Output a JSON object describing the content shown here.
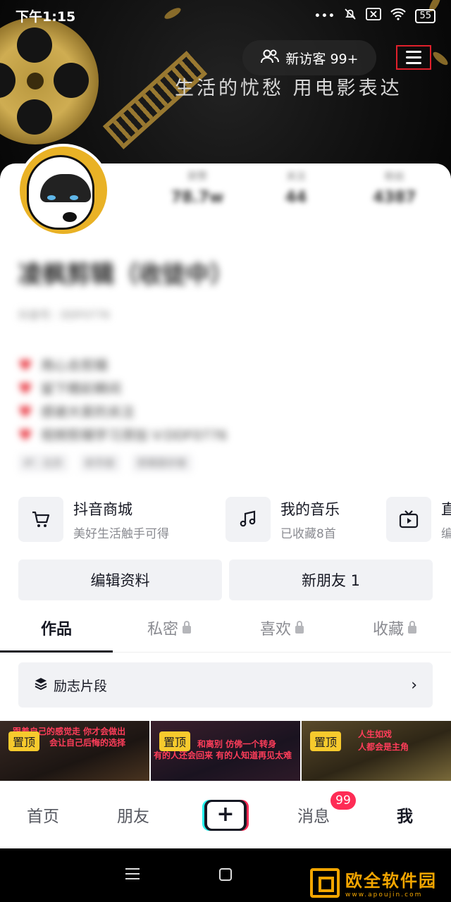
{
  "status_bar": {
    "time": "下午1:15",
    "signal_dots": "•••",
    "battery": "55"
  },
  "header": {
    "visitor_label": "新访客 99+",
    "slogan": "生活的忧愁  用电影表达"
  },
  "profile": {
    "stats": [
      {
        "label": "获赞",
        "value": "78.7w"
      },
      {
        "label": "关注",
        "value": "44"
      },
      {
        "label": "粉丝",
        "value": "4387"
      }
    ],
    "nickname": "凌枫剪辑（收徒中）",
    "douyin_id": "抖音号：DDF0776",
    "bio_lines": [
      "用心去剪辑",
      "留下精彩瞬间",
      "感谢大家的关注",
      "视频剪辑学习添加 V:DDF0776"
    ],
    "tags": [
      "IP：北京",
      "射手座",
      "剪辑爱好者"
    ]
  },
  "entries": [
    {
      "title": "抖音商城",
      "subtitle": "美好生活触手可得",
      "icon": "cart-icon"
    },
    {
      "title": "我的音乐",
      "subtitle": "已收藏8首",
      "icon": "music-note-icon"
    },
    {
      "title": "直",
      "subtitle": "编",
      "icon": "tv-icon"
    }
  ],
  "buttons": {
    "edit_profile": "编辑资料",
    "new_friends": "新朋友 1"
  },
  "tabs": [
    "作品",
    "私密",
    "喜欢",
    "收藏"
  ],
  "collection": {
    "label": "励志片段"
  },
  "videos": [
    {
      "pin": "置顶",
      "caption_1": "跟着自己的感觉走 你才会做出",
      "caption_2": "会让自己后悔的选择"
    },
    {
      "pin": "置顶",
      "caption_1": "和离别 仿佛一个转身",
      "caption_2": "有的人还会回来 有的人知道再见太难"
    },
    {
      "pin": "置顶",
      "caption_1": "人生如戏",
      "caption_2": "人都会是主角"
    }
  ],
  "bottom_nav": {
    "home": "首页",
    "friends": "朋友",
    "plus": "+",
    "messages": "消息",
    "me": "我",
    "badge": "99"
  },
  "watermark": {
    "name": "欧全软件园",
    "url": "www.apoujin.com"
  },
  "colors": {
    "accent_red": "#fe2c55",
    "pin_yellow": "#f7ca2d",
    "highlight_box": "#e0202b"
  }
}
